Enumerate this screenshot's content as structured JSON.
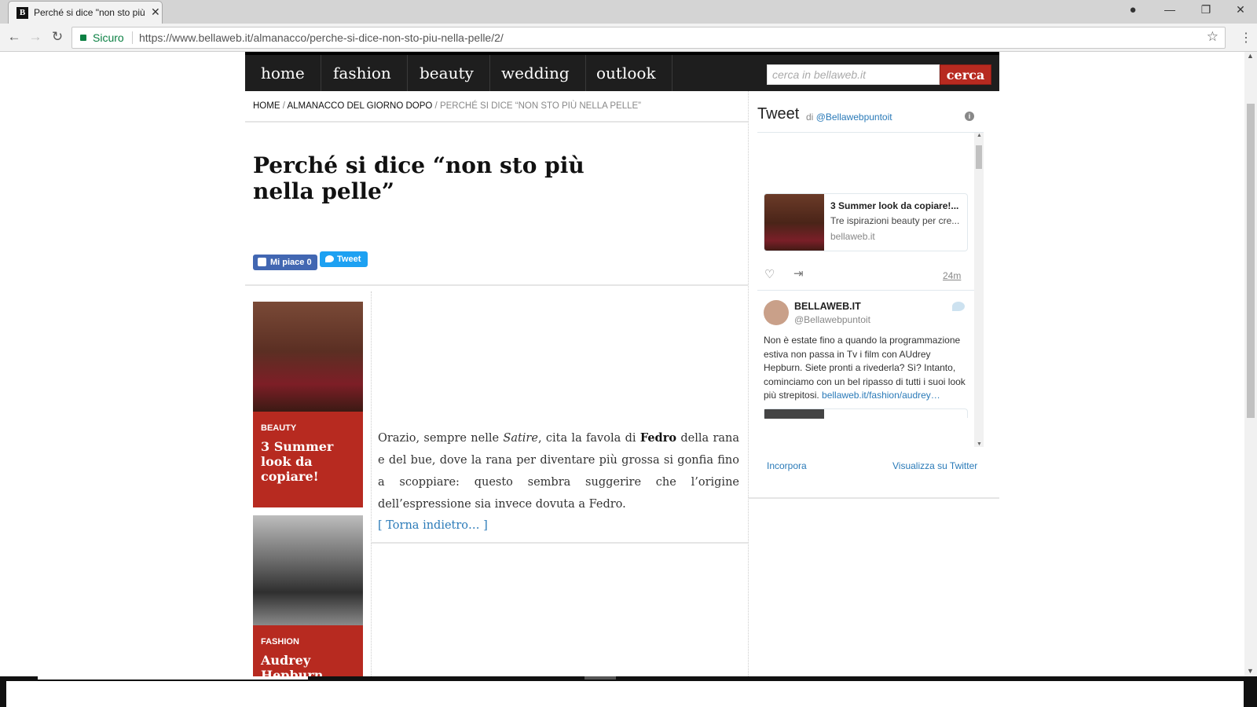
{
  "browser": {
    "tab_title": "Perché si dice \"non sto più nella pelle\"",
    "favicon_letter": "B",
    "secure_label": "Sicuro",
    "url": "https://www.bellaweb.it/almanacco/perche-si-dice-non-sto-piu-nella-pelle/2/"
  },
  "nav": {
    "items": [
      "home",
      "fashion",
      "beauty",
      "wedding",
      "outlook"
    ],
    "search_placeholder": "cerca in bellaweb.it",
    "search_button": "cerca"
  },
  "breadcrumb": {
    "home": "HOME",
    "sep1": " / ",
    "section": "ALMANACCO DEL GIORNO DOPO",
    "sep2": " / ",
    "current": "PERCHÉ SI DICE “NON STO PIÙ NELLA PELLE”"
  },
  "article": {
    "title": "Perché si dice “non sto più nella pelle”",
    "like_label": "Mi piace 0",
    "tweet_label": "Tweet",
    "body_pre": "Orazio, sempre nelle ",
    "body_em": "Satire",
    "body_mid": ", cita la favola di ",
    "body_strong": "Fedro",
    "body_post": " della rana e del bue, dove la rana per diventare più grossa si gonfia fino a scoppiare: questo sembra suggerire che l’origine dell’espressione sia invece dovuta a Fedro.",
    "back_link": "[ Torna indietro… ]"
  },
  "related": [
    {
      "category": "BEAUTY",
      "title": "3 Summer look da copiare!"
    },
    {
      "category": "FASHION",
      "title": "Audrey Hepburn, tutti i look"
    }
  ],
  "twitter_widget": {
    "title": "Tweet",
    "by_prefix": "di ",
    "by_handle": "@Bellawebpuntoit",
    "card_title": "3 Summer look da copiare!...",
    "card_desc": "Tre ispirazioni beauty per cre...",
    "card_domain": "bellaweb.it",
    "time_ago": "24m",
    "user_name": "BELLAWEB.IT",
    "user_handle": "@Bellawebpuntoit",
    "tweet_text": "Non è estate fino a quando la programmazione estiva non passa in Tv i film con AUdrey Hepburn. Siete pronti a rivederla? Sì? Intanto, cominciamo con un bel ripasso di tutti i suoi look più strepitosi. ",
    "tweet_link": "bellaweb.it/fashion/audrey…",
    "embed_label": "Incorpora",
    "view_label": "Visualizza su Twitter"
  },
  "colors": {
    "accent": "#b72a20",
    "nav_bg": "#1e1e1e",
    "link": "#2a7ab8",
    "twitter": "#1da1f2",
    "facebook": "#4267b2"
  }
}
